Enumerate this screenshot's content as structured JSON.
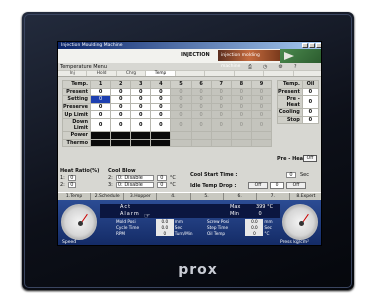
{
  "device": {
    "brand": "prox"
  },
  "window": {
    "title": "Injection Moulding Machine"
  },
  "header": {
    "injection_label": "INJECTION",
    "machine_label": "injection molding machine"
  },
  "menu": {
    "label": "Temperature Menu"
  },
  "toolbar": {
    "items": [
      "Inj",
      "Hold",
      "Chrg",
      "Temp",
      "",
      "",
      "",
      "",
      ""
    ],
    "active_index": 3
  },
  "temp_grid": {
    "corner": "Temp.",
    "columns": [
      "1",
      "2",
      "3",
      "4",
      "5",
      "6",
      "7",
      "8",
      "9"
    ],
    "rows": [
      {
        "label": "Present",
        "values": [
          "0",
          "0",
          "0",
          "0",
          "0",
          "0",
          "0",
          "0",
          "0"
        ]
      },
      {
        "label": "Setting",
        "values": [
          "0",
          "0",
          "0",
          "0",
          "0",
          "0",
          "0",
          "0",
          "0"
        ]
      },
      {
        "label": "Preserve",
        "values": [
          "0",
          "0",
          "0",
          "0",
          "0",
          "0",
          "0",
          "0",
          "0"
        ]
      },
      {
        "label": "Up Limit",
        "values": [
          "0",
          "0",
          "0",
          "0",
          "0",
          "0",
          "0",
          "0",
          "0"
        ]
      },
      {
        "label": "Down Limit",
        "values": [
          "0",
          "0",
          "0",
          "0",
          "0",
          "0",
          "0",
          "0",
          "0"
        ]
      },
      {
        "label": "Power",
        "values": [
          "",
          "",
          "",
          "",
          "",
          "",
          "",
          "",
          ""
        ]
      },
      {
        "label": "Thermo",
        "values": [
          "",
          "",
          "",
          "",
          "",
          "",
          "",
          "",
          ""
        ]
      }
    ],
    "enabled_columns": 4
  },
  "oil": {
    "header": [
      "Temp.",
      "Oil"
    ],
    "rows": [
      {
        "label": "Present",
        "value": "0"
      },
      {
        "label": "Pre - Heat",
        "value": "0"
      },
      {
        "label": "Cooling",
        "value": "0"
      },
      {
        "label": "Stop",
        "value": "0"
      }
    ],
    "preheat_label": "Pre - Heat",
    "preheat_button": "Off"
  },
  "heat_ratio": {
    "title": "Heat Ratio(%)",
    "rows": [
      {
        "idx": "1:",
        "value": "0"
      },
      {
        "idx": "2:",
        "value": "0"
      }
    ]
  },
  "cool_blow": {
    "title": "Cool Blow",
    "rows": [
      {
        "idx": "2:",
        "select": "0: Disable",
        "value": "0",
        "unit": "°C"
      },
      {
        "idx": "3:",
        "select": "0: Disable",
        "value": "0",
        "unit": "°C"
      }
    ]
  },
  "cool_start": {
    "label": "Cool Start Time :",
    "value": "0",
    "unit": "Sec"
  },
  "idle_drop": {
    "label": "Idle Temp Drop :",
    "off1": "Off",
    "value": "0",
    "off2": "Off"
  },
  "tabs": [
    "1.Temp",
    "2.Schedule",
    "3.Hopper",
    "4.",
    "5.",
    "6.",
    "7.",
    "8.Expert"
  ],
  "dash": {
    "act": "Act",
    "alarm": "Alarm",
    "max_label": "Max",
    "max_value": "399",
    "max_unit": "°C",
    "min_label": "Min",
    "min_value": "0",
    "left_gauge_label": "Speed",
    "right_gauge_label": "Press  kg/cm²",
    "rows": [
      {
        "l1": "Mold Posi",
        "v1": "0.0",
        "u1": "mm",
        "l2": "Screw Posi",
        "v2": "0.0",
        "u2": "mm"
      },
      {
        "l1": "Cycle Time",
        "v1": "0.0",
        "u1": "Sec",
        "l2": "Step Time",
        "v2": "0.0",
        "u2": "Sec"
      },
      {
        "l1": "RPM",
        "v1": "0",
        "u1": "Turn/Min",
        "l2": "Oil Temp",
        "v2": "0",
        "u2": "°C"
      }
    ]
  }
}
